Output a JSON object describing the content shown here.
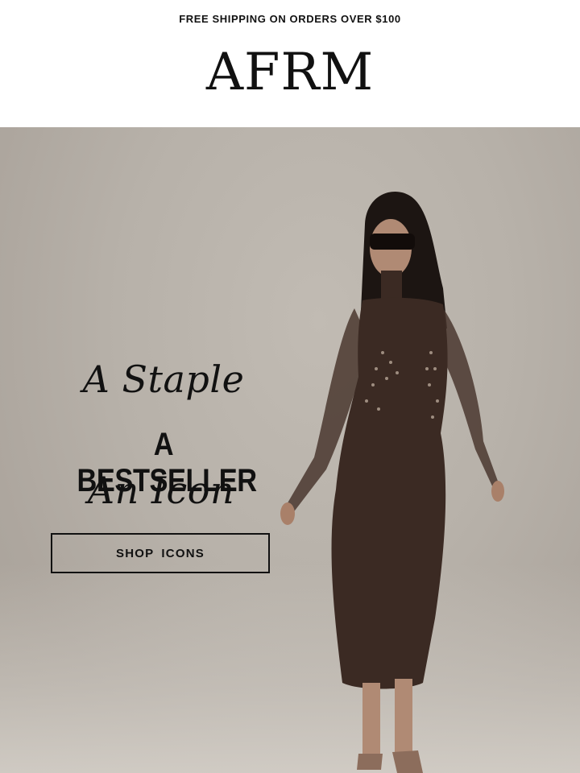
{
  "announcement": {
    "text": "FREE SHIPPING ON ORDERS OVER $100"
  },
  "brand": {
    "logo_text": "AFRM"
  },
  "hero": {
    "line1": "A Staple",
    "line2": "A BESTSELLER",
    "line3": "An Icon",
    "cta_label": "SHOP  ICONS",
    "background_color": "#b7b1a9",
    "dress_color": "#3b2a23"
  }
}
